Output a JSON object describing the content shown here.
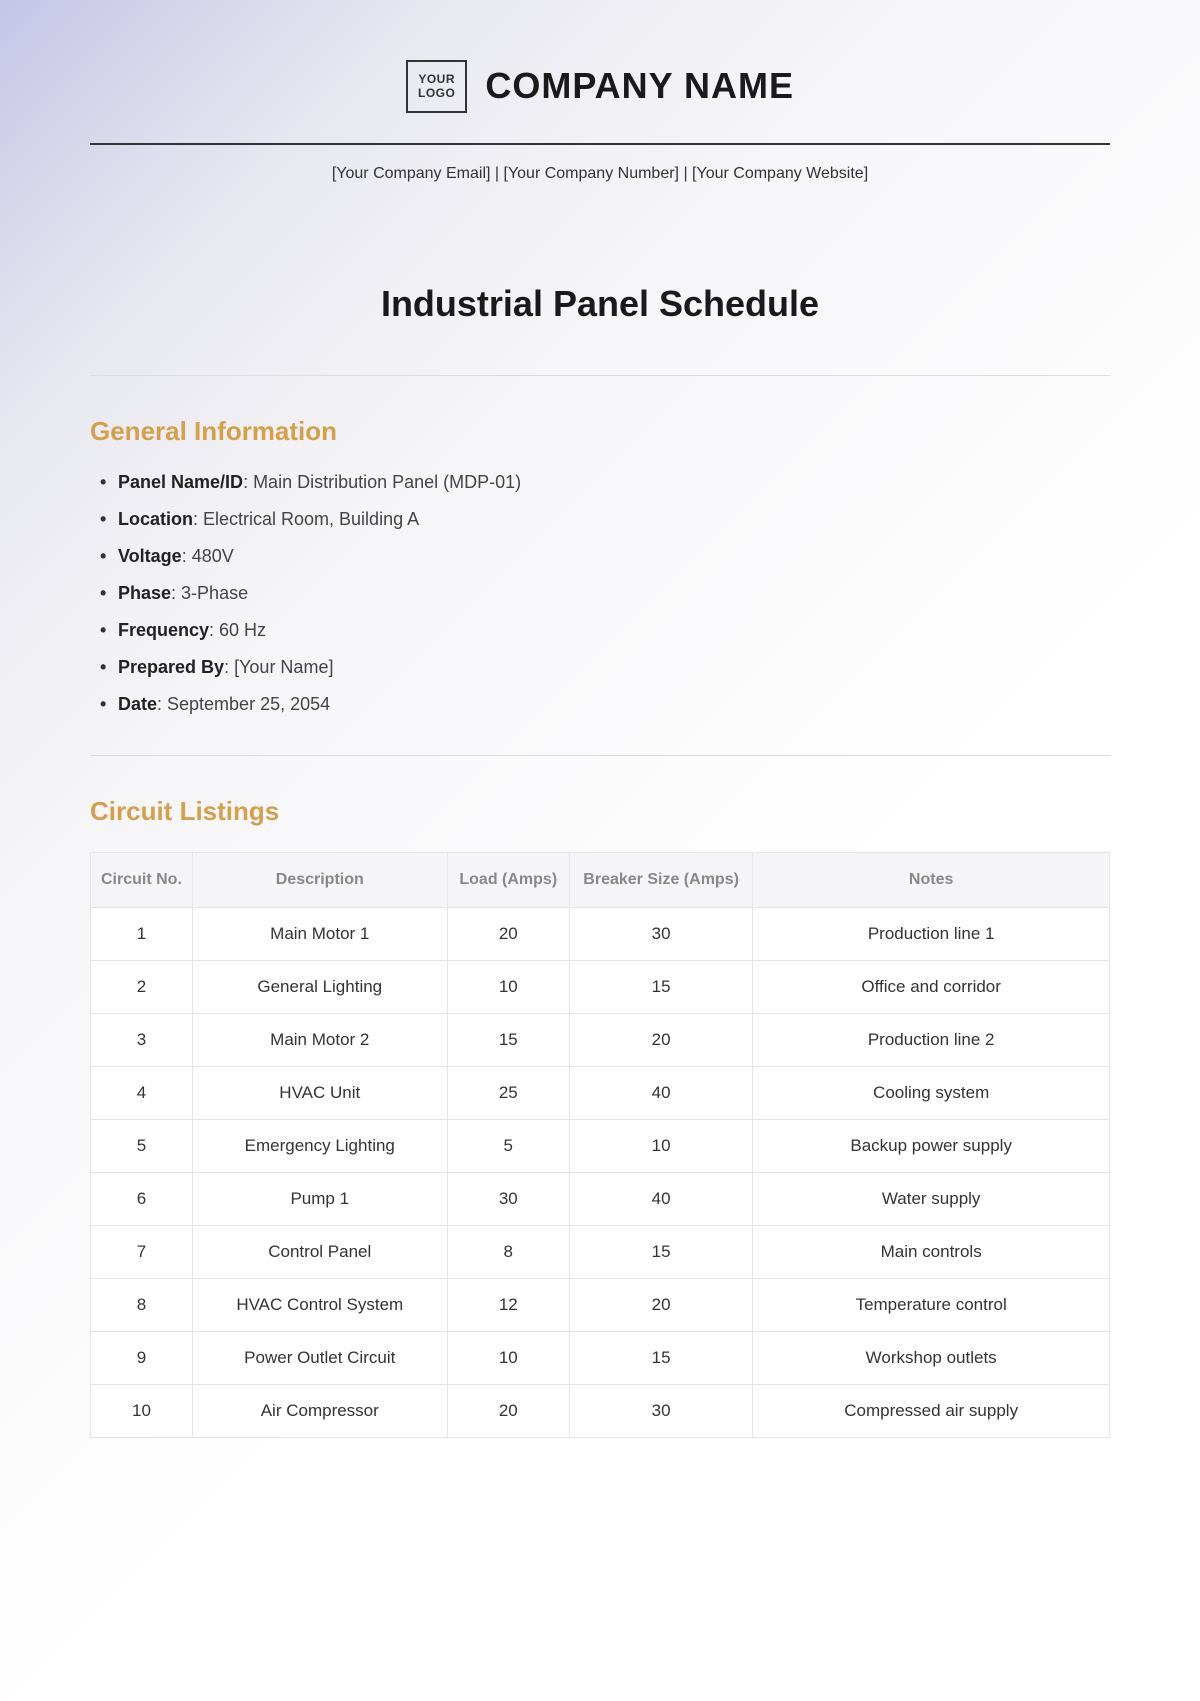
{
  "header": {
    "logo_text": "YOUR\nLOGO",
    "company_name": "COMPANY NAME",
    "contact_line": "[Your Company Email] | [Your Company Number] | [Your Company Website]"
  },
  "document": {
    "title": "Industrial Panel Schedule"
  },
  "general_info": {
    "heading": "General Information",
    "items": [
      {
        "label": "Panel Name/ID",
        "value": "Main Distribution Panel (MDP-01)"
      },
      {
        "label": "Location",
        "value": "Electrical Room, Building A"
      },
      {
        "label": "Voltage",
        "value": "480V"
      },
      {
        "label": "Phase",
        "value": "3-Phase"
      },
      {
        "label": "Frequency",
        "value": "60 Hz"
      },
      {
        "label": "Prepared By",
        "value": "[Your Name]"
      },
      {
        "label": "Date",
        "value": "September 25, 2054"
      }
    ]
  },
  "circuit_listings": {
    "heading": "Circuit Listings",
    "columns": [
      "Circuit No.",
      "Description",
      "Load (Amps)",
      "Breaker Size (Amps)",
      "Notes"
    ],
    "rows": [
      {
        "no": "1",
        "desc": "Main Motor 1",
        "load": "20",
        "breaker": "30",
        "notes": "Production line 1"
      },
      {
        "no": "2",
        "desc": "General Lighting",
        "load": "10",
        "breaker": "15",
        "notes": "Office and corridor"
      },
      {
        "no": "3",
        "desc": "Main Motor 2",
        "load": "15",
        "breaker": "20",
        "notes": "Production line 2"
      },
      {
        "no": "4",
        "desc": "HVAC Unit",
        "load": "25",
        "breaker": "40",
        "notes": "Cooling system"
      },
      {
        "no": "5",
        "desc": "Emergency Lighting",
        "load": "5",
        "breaker": "10",
        "notes": "Backup power supply"
      },
      {
        "no": "6",
        "desc": "Pump 1",
        "load": "30",
        "breaker": "40",
        "notes": "Water supply"
      },
      {
        "no": "7",
        "desc": "Control Panel",
        "load": "8",
        "breaker": "15",
        "notes": "Main controls"
      },
      {
        "no": "8",
        "desc": "HVAC Control System",
        "load": "12",
        "breaker": "20",
        "notes": "Temperature control"
      },
      {
        "no": "9",
        "desc": "Power Outlet Circuit",
        "load": "10",
        "breaker": "15",
        "notes": "Workshop outlets"
      },
      {
        "no": "10",
        "desc": "Air Compressor",
        "load": "20",
        "breaker": "30",
        "notes": "Compressed air supply"
      }
    ]
  }
}
